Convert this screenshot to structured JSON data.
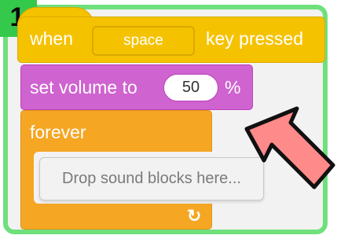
{
  "step_badge": "1",
  "hat_block": {
    "when_label": "when",
    "key_value": "space",
    "suffix_label": "key pressed"
  },
  "volume_block": {
    "label": "set volume to",
    "value": "50",
    "unit": "%"
  },
  "forever_block": {
    "label": "forever",
    "drop_placeholder": "Drop sound blocks here...",
    "loop_icon": "loop-arrow-icon"
  },
  "colors": {
    "frame": "#6fe07b",
    "badge": "#35c94b",
    "events": "#f5c200",
    "sound": "#cf63cf",
    "control": "#f5a623",
    "arrow_fill": "#ff8a8a",
    "arrow_stroke": "#111111"
  }
}
